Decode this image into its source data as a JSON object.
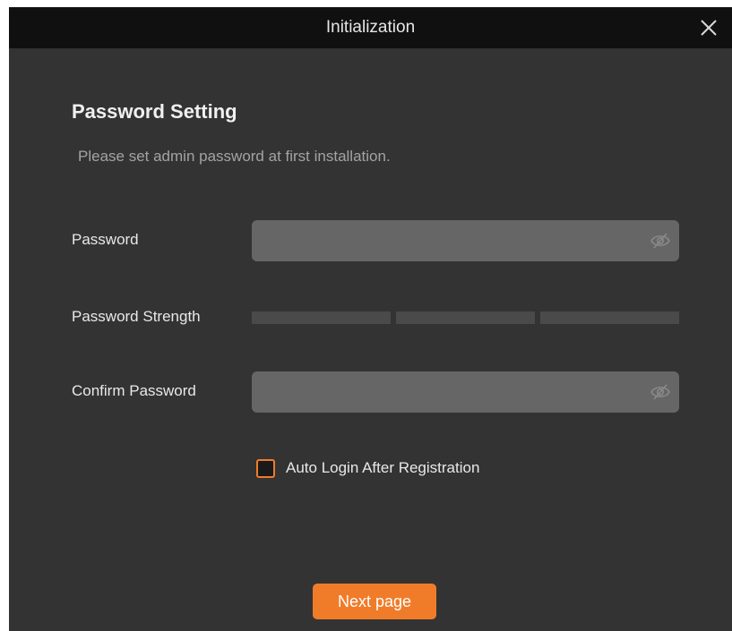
{
  "window": {
    "title": "Initialization",
    "close_icon": "close-icon"
  },
  "section": {
    "title": "Password Setting",
    "description": "Please set admin password at first installation."
  },
  "password": {
    "label": "Password",
    "value": "",
    "placeholder": "",
    "icon": "eye-slash-icon"
  },
  "strength": {
    "label": "Password Strength",
    "segments": 3,
    "level": 0
  },
  "confirm": {
    "label": "Confirm Password",
    "value": "",
    "placeholder": "",
    "icon": "eye-slash-icon"
  },
  "auto_login": {
    "label": "Auto Login After Registration",
    "checked": false
  },
  "footer": {
    "next_label": "Next page"
  },
  "colors": {
    "accent": "#f07c2a",
    "dialog_bg": "#333333",
    "titlebar_bg": "#101010",
    "input_bg": "#666666",
    "strength_empty": "#4a4a4a"
  }
}
